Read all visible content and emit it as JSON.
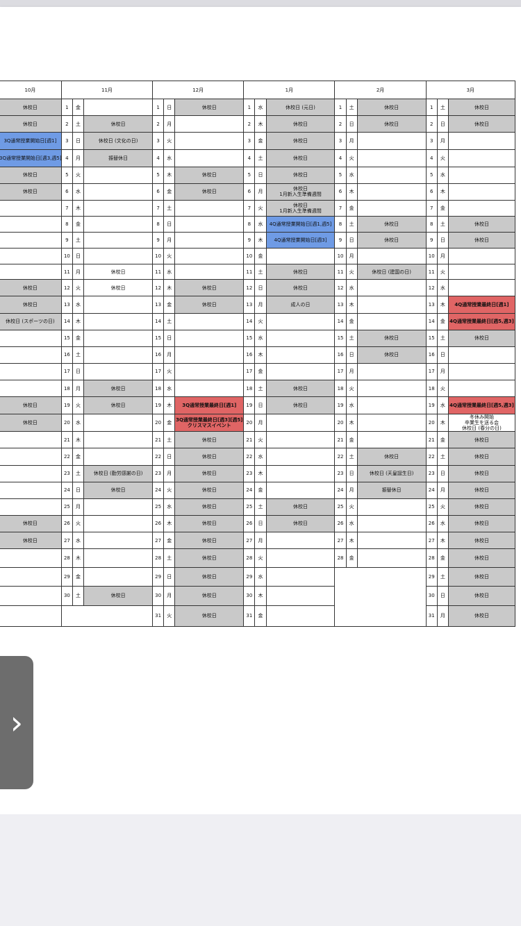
{
  "months": [
    "10月",
    "11月",
    "12月",
    "1月",
    "2月",
    "3月"
  ],
  "rows": [
    {
      "oct": {
        "t": "休校日",
        "c": "g"
      },
      "nov": {
        "d": "1",
        "w": "金",
        "t": "",
        "c": ""
      },
      "dec": {
        "d": "1",
        "w": "日",
        "t": "休校日",
        "c": "g"
      },
      "jan": {
        "d": "1",
        "w": "水",
        "t": "休校日 (元日)",
        "c": "g"
      },
      "feb": {
        "d": "1",
        "w": "土",
        "t": "休校日",
        "c": "g"
      },
      "mar": {
        "d": "1",
        "w": "土",
        "t": "休校日",
        "c": "g"
      }
    },
    {
      "oct": {
        "t": "休校日",
        "c": "g"
      },
      "nov": {
        "d": "2",
        "w": "土",
        "t": "休校日",
        "c": "g"
      },
      "dec": {
        "d": "2",
        "w": "月",
        "t": "",
        "c": ""
      },
      "jan": {
        "d": "2",
        "w": "木",
        "t": "休校日",
        "c": "g"
      },
      "feb": {
        "d": "2",
        "w": "日",
        "t": "休校日",
        "c": "g"
      },
      "mar": {
        "d": "2",
        "w": "日",
        "t": "休校日",
        "c": "g"
      }
    },
    {
      "oct": {
        "t": "3Q通常授業開始日[週1]",
        "c": "b"
      },
      "nov": {
        "d": "3",
        "w": "日",
        "t": "休校日 (文化の日)",
        "c": "g"
      },
      "dec": {
        "d": "3",
        "w": "火",
        "t": "",
        "c": ""
      },
      "jan": {
        "d": "3",
        "w": "金",
        "t": "休校日",
        "c": "g"
      },
      "feb": {
        "d": "3",
        "w": "月",
        "t": "",
        "c": ""
      },
      "mar": {
        "d": "3",
        "w": "月",
        "t": "",
        "c": ""
      }
    },
    {
      "oct": {
        "t": "3Q通常授業開始日[週3,週5]",
        "c": "b"
      },
      "nov": {
        "d": "4",
        "w": "月",
        "t": "振替休日",
        "c": "g"
      },
      "dec": {
        "d": "4",
        "w": "水",
        "t": "",
        "c": ""
      },
      "jan": {
        "d": "4",
        "w": "土",
        "t": "休校日",
        "c": "g"
      },
      "feb": {
        "d": "4",
        "w": "火",
        "t": "",
        "c": ""
      },
      "mar": {
        "d": "4",
        "w": "火",
        "t": "",
        "c": ""
      }
    },
    {
      "oct": {
        "t": "休校日",
        "c": "g"
      },
      "nov": {
        "d": "5",
        "w": "火",
        "t": "",
        "c": ""
      },
      "dec": {
        "d": "5",
        "w": "木",
        "t": "休校日",
        "c": "g"
      },
      "jan": {
        "d": "5",
        "w": "日",
        "t": "休校日",
        "c": "g"
      },
      "feb": {
        "d": "5",
        "w": "水",
        "t": "",
        "c": ""
      },
      "mar": {
        "d": "5",
        "w": "水",
        "t": "",
        "c": ""
      }
    },
    {
      "oct": {
        "t": "休校日",
        "c": "g"
      },
      "nov": {
        "d": "6",
        "w": "水",
        "t": "",
        "c": ""
      },
      "dec": {
        "d": "6",
        "w": "金",
        "t": "休校日",
        "c": "g"
      },
      "jan": {
        "d": "6",
        "w": "月",
        "t": "休校日\n1月新入生準備週間",
        "c": "g"
      },
      "feb": {
        "d": "6",
        "w": "木",
        "t": "",
        "c": ""
      },
      "mar": {
        "d": "6",
        "w": "木",
        "t": "",
        "c": ""
      }
    },
    {
      "oct": {
        "t": "",
        "c": ""
      },
      "nov": {
        "d": "7",
        "w": "木",
        "t": "",
        "c": ""
      },
      "dec": {
        "d": "7",
        "w": "土",
        "t": "",
        "c": ""
      },
      "jan": {
        "d": "7",
        "w": "火",
        "t": "休校日\n1月新入生準備週間",
        "c": "g"
      },
      "feb": {
        "d": "7",
        "w": "金",
        "t": "",
        "c": ""
      },
      "mar": {
        "d": "7",
        "w": "金",
        "t": "",
        "c": ""
      }
    },
    {
      "oct": {
        "t": "",
        "c": ""
      },
      "nov": {
        "d": "8",
        "w": "金",
        "t": "",
        "c": ""
      },
      "dec": {
        "d": "8",
        "w": "日",
        "t": "",
        "c": ""
      },
      "jan": {
        "d": "8",
        "w": "水",
        "t": "4Q通常授業開始日[週1,週5]",
        "c": "b"
      },
      "feb": {
        "d": "8",
        "w": "土",
        "t": "休校日",
        "c": "g"
      },
      "mar": {
        "d": "8",
        "w": "土",
        "t": "休校日",
        "c": "g"
      }
    },
    {
      "oct": {
        "t": "",
        "c": ""
      },
      "nov": {
        "d": "9",
        "w": "土",
        "t": "",
        "c": ""
      },
      "dec": {
        "d": "9",
        "w": "月",
        "t": "",
        "c": ""
      },
      "jan": {
        "d": "9",
        "w": "木",
        "t": "4Q通常授業開始日[週3]",
        "c": "b"
      },
      "feb": {
        "d": "9",
        "w": "日",
        "t": "休校日",
        "c": "g"
      },
      "mar": {
        "d": "9",
        "w": "日",
        "t": "休校日",
        "c": "g"
      }
    },
    {
      "oct": {
        "t": "",
        "c": ""
      },
      "nov": {
        "d": "10",
        "w": "日",
        "t": "",
        "c": ""
      },
      "dec": {
        "d": "10",
        "w": "火",
        "t": "",
        "c": ""
      },
      "jan": {
        "d": "10",
        "w": "金",
        "t": "",
        "c": ""
      },
      "feb": {
        "d": "10",
        "w": "月",
        "t": "",
        "c": ""
      },
      "mar": {
        "d": "10",
        "w": "月",
        "t": "",
        "c": ""
      }
    },
    {
      "oct": {
        "t": "",
        "c": ""
      },
      "nov": {
        "d": "11",
        "w": "月",
        "t": "休校日",
        "c": ""
      },
      "dec": {
        "d": "11",
        "w": "水",
        "t": "",
        "c": ""
      },
      "jan": {
        "d": "11",
        "w": "土",
        "t": "休校日",
        "c": "g"
      },
      "feb": {
        "d": "11",
        "w": "火",
        "t": "休校日 (建国の日)",
        "c": "g"
      },
      "mar": {
        "d": "11",
        "w": "火",
        "t": "",
        "c": ""
      }
    },
    {
      "oct": {
        "t": "休校日",
        "c": "g"
      },
      "nov": {
        "d": "12",
        "w": "火",
        "t": "休校日",
        "c": ""
      },
      "dec": {
        "d": "12",
        "w": "木",
        "t": "休校日",
        "c": "g"
      },
      "jan": {
        "d": "12",
        "w": "日",
        "t": "休校日",
        "c": "g"
      },
      "feb": {
        "d": "12",
        "w": "水",
        "t": "",
        "c": ""
      },
      "mar": {
        "d": "12",
        "w": "水",
        "t": "",
        "c": ""
      }
    },
    {
      "oct": {
        "t": "休校日",
        "c": "g"
      },
      "nov": {
        "d": "13",
        "w": "水",
        "t": "",
        "c": ""
      },
      "dec": {
        "d": "13",
        "w": "金",
        "t": "休校日",
        "c": "g"
      },
      "jan": {
        "d": "13",
        "w": "月",
        "t": "成人の日",
        "c": "g"
      },
      "feb": {
        "d": "13",
        "w": "木",
        "t": "",
        "c": ""
      },
      "mar": {
        "d": "13",
        "w": "木",
        "t": "4Q通常授業最終日[週1]",
        "c": "r"
      }
    },
    {
      "oct": {
        "t": "休校日 (スポーツの日)",
        "c": "g"
      },
      "nov": {
        "d": "14",
        "w": "木",
        "t": "",
        "c": ""
      },
      "dec": {
        "d": "14",
        "w": "土",
        "t": "",
        "c": ""
      },
      "jan": {
        "d": "14",
        "w": "火",
        "t": "",
        "c": ""
      },
      "feb": {
        "d": "14",
        "w": "金",
        "t": "",
        "c": ""
      },
      "mar": {
        "d": "14",
        "w": "金",
        "t": "4Q通常授業最終日[週5,週3]",
        "c": "r"
      }
    },
    {
      "oct": {
        "t": "",
        "c": ""
      },
      "nov": {
        "d": "15",
        "w": "金",
        "t": "",
        "c": ""
      },
      "dec": {
        "d": "15",
        "w": "日",
        "t": "",
        "c": ""
      },
      "jan": {
        "d": "15",
        "w": "水",
        "t": "",
        "c": ""
      },
      "feb": {
        "d": "15",
        "w": "土",
        "t": "休校日",
        "c": "g"
      },
      "mar": {
        "d": "15",
        "w": "土",
        "t": "休校日",
        "c": "g"
      }
    },
    {
      "oct": {
        "t": "",
        "c": ""
      },
      "nov": {
        "d": "16",
        "w": "土",
        "t": "",
        "c": ""
      },
      "dec": {
        "d": "16",
        "w": "月",
        "t": "",
        "c": ""
      },
      "jan": {
        "d": "16",
        "w": "木",
        "t": "",
        "c": ""
      },
      "feb": {
        "d": "16",
        "w": "日",
        "t": "休校日",
        "c": "g"
      },
      "mar": {
        "d": "16",
        "w": "日",
        "t": "",
        "c": ""
      }
    },
    {
      "oct": {
        "t": "",
        "c": ""
      },
      "nov": {
        "d": "17",
        "w": "日",
        "t": "",
        "c": ""
      },
      "dec": {
        "d": "17",
        "w": "火",
        "t": "",
        "c": ""
      },
      "jan": {
        "d": "17",
        "w": "金",
        "t": "",
        "c": ""
      },
      "feb": {
        "d": "17",
        "w": "月",
        "t": "",
        "c": ""
      },
      "mar": {
        "d": "17",
        "w": "月",
        "t": "",
        "c": ""
      }
    },
    {
      "oct": {
        "t": "",
        "c": ""
      },
      "nov": {
        "d": "18",
        "w": "月",
        "t": "休校日",
        "c": "g"
      },
      "dec": {
        "d": "18",
        "w": "水",
        "t": "",
        "c": ""
      },
      "jan": {
        "d": "18",
        "w": "土",
        "t": "休校日",
        "c": "g"
      },
      "feb": {
        "d": "18",
        "w": "火",
        "t": "",
        "c": ""
      },
      "mar": {
        "d": "18",
        "w": "火",
        "t": "",
        "c": ""
      }
    },
    {
      "oct": {
        "t": "休校日",
        "c": "g"
      },
      "nov": {
        "d": "19",
        "w": "火",
        "t": "休校日",
        "c": "g"
      },
      "dec": {
        "d": "19",
        "w": "木",
        "t": "3Q通常授業最終日[週1]",
        "c": "r"
      },
      "jan": {
        "d": "19",
        "w": "日",
        "t": "休校日",
        "c": "g"
      },
      "feb": {
        "d": "19",
        "w": "水",
        "t": "",
        "c": ""
      },
      "mar": {
        "d": "19",
        "w": "水",
        "t": "4Q通常授業最終日[週5,週3]",
        "c": "r"
      }
    },
    {
      "oct": {
        "t": "休校日",
        "c": "g"
      },
      "nov": {
        "d": "20",
        "w": "水",
        "t": "",
        "c": ""
      },
      "dec": {
        "d": "20",
        "w": "金",
        "t": "3Q通常授業最終日[週3][週5]\nクリスマスイベント",
        "c": "r"
      },
      "jan": {
        "d": "20",
        "w": "月",
        "t": "",
        "c": ""
      },
      "feb": {
        "d": "20",
        "w": "木",
        "t": "",
        "c": ""
      },
      "mar": {
        "d": "20",
        "w": "木",
        "t": "冬休み開始\n卒業生を送る会\n休校日 (春分の日)",
        "c": ""
      }
    },
    {
      "oct": {
        "t": "",
        "c": ""
      },
      "nov": {
        "d": "21",
        "w": "木",
        "t": "",
        "c": ""
      },
      "dec": {
        "d": "21",
        "w": "土",
        "t": "休校日",
        "c": "g"
      },
      "jan": {
        "d": "21",
        "w": "火",
        "t": "",
        "c": ""
      },
      "feb": {
        "d": "21",
        "w": "金",
        "t": "",
        "c": ""
      },
      "mar": {
        "d": "21",
        "w": "金",
        "t": "休校日",
        "c": "g"
      }
    },
    {
      "oct": {
        "t": "",
        "c": ""
      },
      "nov": {
        "d": "22",
        "w": "金",
        "t": "",
        "c": ""
      },
      "dec": {
        "d": "22",
        "w": "日",
        "t": "休校日",
        "c": "g"
      },
      "jan": {
        "d": "22",
        "w": "水",
        "t": "",
        "c": ""
      },
      "feb": {
        "d": "22",
        "w": "土",
        "t": "休校日",
        "c": "g"
      },
      "mar": {
        "d": "22",
        "w": "土",
        "t": "休校日",
        "c": "g"
      }
    },
    {
      "oct": {
        "t": "",
        "c": ""
      },
      "nov": {
        "d": "23",
        "w": "土",
        "t": "休校日 (勤労感謝の日)",
        "c": "g"
      },
      "dec": {
        "d": "23",
        "w": "月",
        "t": "休校日",
        "c": "g"
      },
      "jan": {
        "d": "23",
        "w": "木",
        "t": "",
        "c": ""
      },
      "feb": {
        "d": "23",
        "w": "日",
        "t": "休校日 (天皇誕生日)",
        "c": "g"
      },
      "mar": {
        "d": "23",
        "w": "日",
        "t": "休校日",
        "c": "g"
      }
    },
    {
      "oct": {
        "t": "",
        "c": ""
      },
      "nov": {
        "d": "24",
        "w": "日",
        "t": "休校日",
        "c": "g"
      },
      "dec": {
        "d": "24",
        "w": "火",
        "t": "休校日",
        "c": "g"
      },
      "jan": {
        "d": "24",
        "w": "金",
        "t": "",
        "c": ""
      },
      "feb": {
        "d": "24",
        "w": "月",
        "t": "振替休日",
        "c": "g"
      },
      "mar": {
        "d": "24",
        "w": "月",
        "t": "休校日",
        "c": "g"
      }
    },
    {
      "oct": {
        "t": "",
        "c": ""
      },
      "nov": {
        "d": "25",
        "w": "月",
        "t": "",
        "c": ""
      },
      "dec": {
        "d": "25",
        "w": "水",
        "t": "休校日",
        "c": "g"
      },
      "jan": {
        "d": "25",
        "w": "土",
        "t": "休校日",
        "c": "g"
      },
      "feb": {
        "d": "25",
        "w": "火",
        "t": "",
        "c": ""
      },
      "mar": {
        "d": "25",
        "w": "火",
        "t": "休校日",
        "c": "g"
      }
    },
    {
      "oct": {
        "t": "休校日",
        "c": "g"
      },
      "nov": {
        "d": "26",
        "w": "火",
        "t": "",
        "c": ""
      },
      "dec": {
        "d": "26",
        "w": "木",
        "t": "休校日",
        "c": "g"
      },
      "jan": {
        "d": "26",
        "w": "日",
        "t": "休校日",
        "c": "g"
      },
      "feb": {
        "d": "26",
        "w": "水",
        "t": "",
        "c": ""
      },
      "mar": {
        "d": "26",
        "w": "水",
        "t": "休校日",
        "c": "g"
      }
    },
    {
      "oct": {
        "t": "休校日",
        "c": "g"
      },
      "nov": {
        "d": "27",
        "w": "水",
        "t": "",
        "c": ""
      },
      "dec": {
        "d": "27",
        "w": "金",
        "t": "休校日",
        "c": "g"
      },
      "jan": {
        "d": "27",
        "w": "月",
        "t": "",
        "c": ""
      },
      "feb": {
        "d": "27",
        "w": "木",
        "t": "",
        "c": ""
      },
      "mar": {
        "d": "27",
        "w": "木",
        "t": "休校日",
        "c": "g"
      }
    },
    {
      "oct": {
        "t": "",
        "c": ""
      },
      "nov": {
        "d": "28",
        "w": "木",
        "t": "",
        "c": ""
      },
      "dec": {
        "d": "28",
        "w": "土",
        "t": "休校日",
        "c": "g"
      },
      "jan": {
        "d": "28",
        "w": "火",
        "t": "",
        "c": ""
      },
      "feb": {
        "d": "28",
        "w": "金",
        "t": "",
        "c": ""
      },
      "mar": {
        "d": "28",
        "w": "金",
        "t": "休校日",
        "c": "g"
      }
    },
    {
      "oct": {
        "t": "",
        "c": ""
      },
      "nov": {
        "d": "29",
        "w": "金",
        "t": "",
        "c": ""
      },
      "dec": {
        "d": "29",
        "w": "日",
        "t": "休校日",
        "c": "g"
      },
      "jan": {
        "d": "29",
        "w": "水",
        "t": "",
        "c": ""
      },
      "feb": null,
      "mar": {
        "d": "29",
        "w": "土",
        "t": "休校日",
        "c": "g"
      }
    },
    {
      "oct": {
        "t": "",
        "c": ""
      },
      "nov": {
        "d": "30",
        "w": "土",
        "t": "休校日",
        "c": "g"
      },
      "dec": {
        "d": "30",
        "w": "月",
        "t": "休校日",
        "c": "g"
      },
      "jan": {
        "d": "30",
        "w": "木",
        "t": "",
        "c": ""
      },
      "feb": null,
      "mar": {
        "d": "30",
        "w": "日",
        "t": "休校日",
        "c": "g"
      }
    },
    {
      "oct": {
        "t": "",
        "c": ""
      },
      "nov": null,
      "dec": {
        "d": "31",
        "w": "火",
        "t": "休校日",
        "c": "g"
      },
      "jan": {
        "d": "31",
        "w": "金",
        "t": "",
        "c": ""
      },
      "feb": null,
      "mar": {
        "d": "31",
        "w": "月",
        "t": "休校日",
        "c": "g"
      }
    }
  ],
  "colors": {
    "holiday": "#c9c9c9",
    "start": "#6f9be5",
    "end": "#e06565"
  },
  "nav": {
    "next_glyph": "›",
    "icon": "chevron-right-icon"
  }
}
